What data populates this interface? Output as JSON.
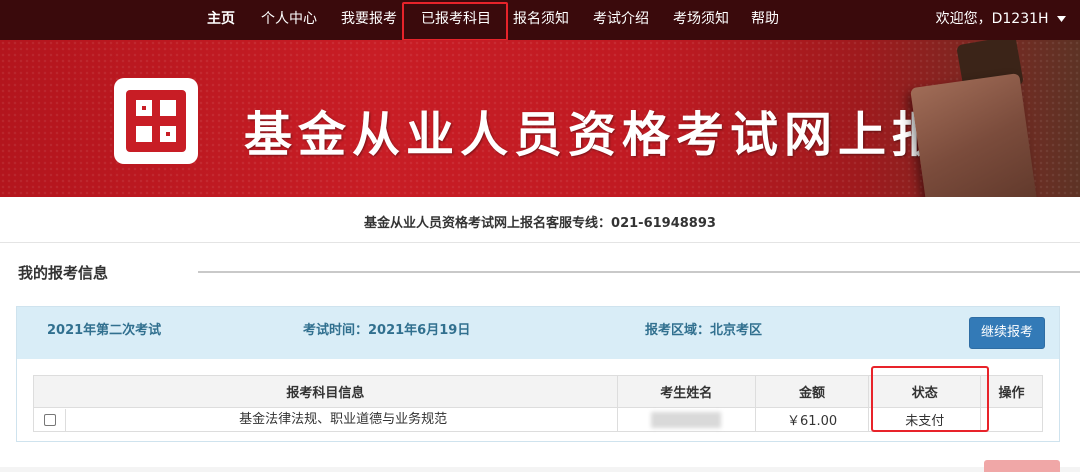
{
  "nav": {
    "items": [
      {
        "label": "主页",
        "active": true
      },
      {
        "label": "个人中心"
      },
      {
        "label": "我要报考"
      },
      {
        "label": "已报考科目"
      },
      {
        "label": "报名须知"
      },
      {
        "label": "考试介绍"
      },
      {
        "label": "考场须知"
      },
      {
        "label": "帮助"
      }
    ],
    "welcome": "欢迎您，D1231H",
    "dropdown_icon": "chevron-down-icon"
  },
  "banner": {
    "title": "基金从业人员资格考试网上报名"
  },
  "hotline": "基金从业人员资格考试网上报名客服专线：021-61948893",
  "section": {
    "title": "我的报考信息"
  },
  "exam": {
    "name": "2021年第二次考试",
    "time": "考试时间：2021年6月19日",
    "region": "报考区域：北京考区",
    "continue_label": "继续报考"
  },
  "table": {
    "headers": [
      "报考科目信息",
      "考生姓名",
      "金额",
      "状态",
      "操作"
    ],
    "rows": [
      {
        "subject": "基金法律法规、职业道德与业务规范",
        "amount": "￥61.00",
        "status": "未支付",
        "operation": ""
      }
    ]
  },
  "colors": {
    "nav_bg": "#3a0a0c",
    "banner_red": "#c81d25",
    "highlight": "#e8232a",
    "button_blue": "#337ab7",
    "panel_head": "#d9edf7"
  }
}
